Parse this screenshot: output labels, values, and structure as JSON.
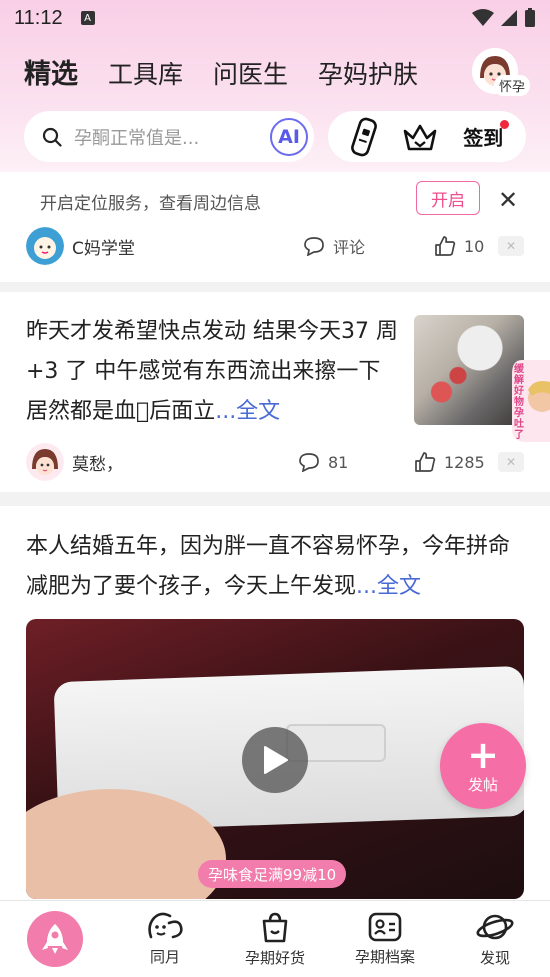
{
  "status_bar": {
    "time": "11:12",
    "a_badge": "A"
  },
  "header": {
    "tabs": [
      {
        "label": "精选",
        "active": true
      },
      {
        "label": "工具库",
        "active": false
      },
      {
        "label": "问医生",
        "active": false
      },
      {
        "label": "孕妈护肤",
        "active": false
      }
    ],
    "profile_label": "怀孕",
    "search_placeholder": "孕酮正常值是...",
    "ai_label": "AI",
    "signin_label": "签到"
  },
  "location_bar": {
    "text": "开启定位服务，查看周边信息",
    "open_button": "开启"
  },
  "posts": [
    {
      "author": "C妈学堂",
      "comment_label": "评论",
      "likes": "10"
    },
    {
      "text": "昨天才发希望快点发动  结果今天37 周+3 了  中午感觉有东西流出来擦一下 居然都是血􏿾后面立",
      "more": "...全文",
      "author": "莫愁，",
      "comments": "81",
      "likes": "1285"
    },
    {
      "text": "本人结婚五年，因为胖一直不容易怀孕，今年拼命减肥为了要个孩子，今天上午发现",
      "more": "...全文"
    }
  ],
  "promo_side": "缓解好物 孕吐了",
  "coupon": "孕味食足满99减10",
  "fab_label": "发帖",
  "bottom_nav": [
    {
      "label": ""
    },
    {
      "label": "同月"
    },
    {
      "label": "孕期好货"
    },
    {
      "label": "孕期档案"
    },
    {
      "label": "发现"
    }
  ],
  "colors": {
    "accent": "#f27cab",
    "link": "#4a6bd6",
    "ai": "#5a5ae8"
  }
}
